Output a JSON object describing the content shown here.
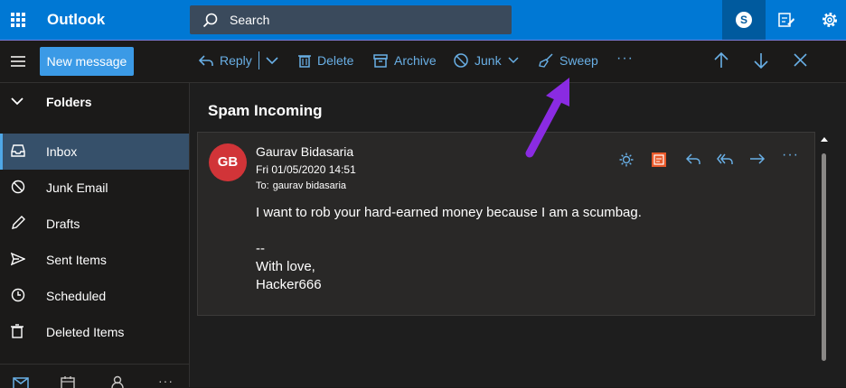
{
  "topbar": {
    "app_name": "Outlook",
    "search_placeholder": "Search",
    "skype_letter": "S"
  },
  "commands": {
    "new_message": "New message",
    "reply": "Reply",
    "delete": "Delete",
    "archive": "Archive",
    "junk": "Junk",
    "sweep": "Sweep",
    "more": "···"
  },
  "sidebar": {
    "header": "Folders",
    "items": [
      {
        "label": "Inbox",
        "icon": "inbox-icon",
        "selected": true
      },
      {
        "label": "Junk Email",
        "icon": "junk-icon"
      },
      {
        "label": "Drafts",
        "icon": "pencil-icon"
      },
      {
        "label": "Sent Items",
        "icon": "send-icon"
      },
      {
        "label": "Scheduled",
        "icon": "clock-icon"
      },
      {
        "label": "Deleted Items",
        "icon": "trash-icon"
      }
    ]
  },
  "reading": {
    "folder_title": "Spam Incoming",
    "message": {
      "avatar_initials": "GB",
      "sender": "Gaurav Bidasaria",
      "date": "Fri 01/05/2020 14:51",
      "to_label": "To:",
      "to_value": "gaurav bidasaria",
      "body_line1": "I want to rob your hard-earned money because I am a scumbag.",
      "body_line2": "--",
      "body_line3": "With love,",
      "body_line4": "Hacker666",
      "more": "···"
    }
  },
  "colors": {
    "topbar": "#0078d4",
    "accent": "#69afe5",
    "avatar": "#d13438",
    "annotation_arrow": "#8a2be2"
  }
}
